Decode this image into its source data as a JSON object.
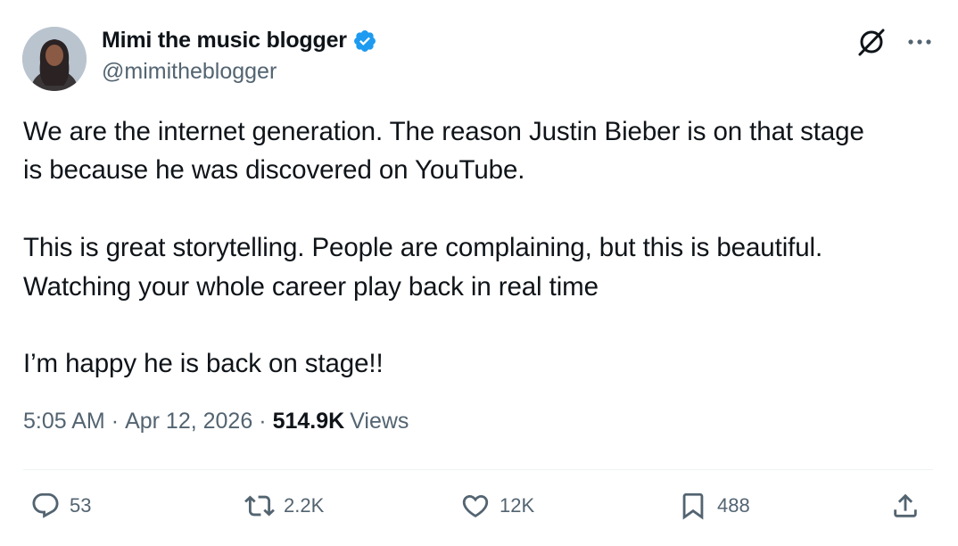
{
  "author": {
    "display_name": "Mimi the music blogger",
    "handle": "@mimitheblogger",
    "verified": true,
    "verified_color": "#1d9bf0"
  },
  "tweet": {
    "text": "We are the internet generation. The reason Justin Bieber is on that stage\nis because he was discovered on YouTube.\n\nThis is great storytelling. People are complaining, but this is beautiful.\nWatching your whole career play back in real time\n\nI’m happy he is back on stage!!",
    "time": "5:05 AM",
    "date": "Apr 12, 2026",
    "separator": "·",
    "views_count": "514.9K",
    "views_label": "Views"
  },
  "actions": {
    "reply_count": "53",
    "repost_count": "2.2K",
    "like_count": "12K",
    "bookmark_count": "488"
  },
  "icons": {
    "top_right": [
      "grok-icon",
      "more-icon"
    ],
    "actions": [
      "reply-icon",
      "repost-icon",
      "like-icon",
      "bookmark-icon",
      "share-icon"
    ]
  },
  "colors": {
    "text": "#0f1419",
    "secondary": "#536471",
    "divider": "#eff3f4"
  }
}
